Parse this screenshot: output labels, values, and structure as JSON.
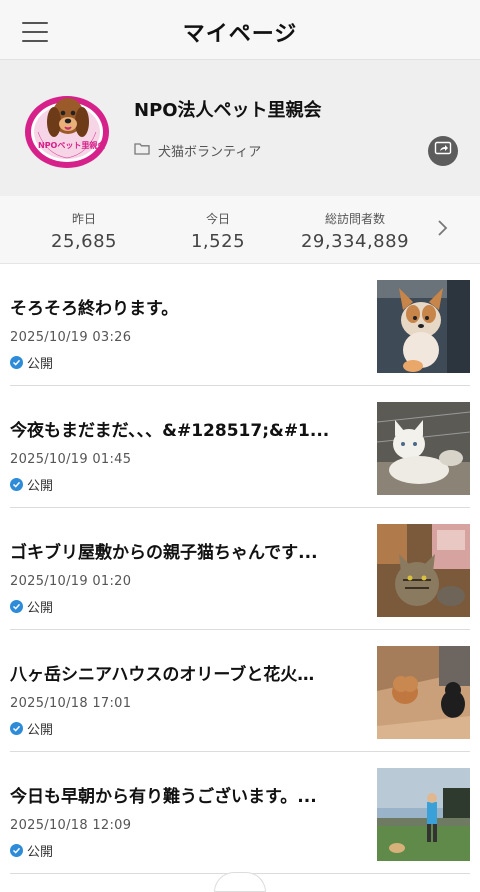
{
  "header": {
    "title": "マイページ"
  },
  "profile": {
    "blog_name": "NPO法人ペット里親会",
    "category": "犬猫ボランティア",
    "logo_text": "NPOペット里親会"
  },
  "stats": [
    {
      "label": "昨日",
      "value": "25,685"
    },
    {
      "label": "今日",
      "value": "1,525"
    },
    {
      "label": "総訪問者数",
      "value": "29,334,889"
    }
  ],
  "posts": [
    {
      "title": "そろそろ終わります。",
      "date": "2025/10/19 03:26",
      "status": "公開",
      "thumb": "corgi-puppy"
    },
    {
      "title": "今夜もまだまだ、、、&#128517;&#1...",
      "date": "2025/10/19 01:45",
      "status": "公開",
      "thumb": "white-kitten"
    },
    {
      "title": "ゴキブリ屋敷からの親子猫ちゃんです...",
      "date": "2025/10/19 01:20",
      "status": "公開",
      "thumb": "tabby-cats"
    },
    {
      "title": "八ヶ岳シニアハウスのオリーブと花火…",
      "date": "2025/10/18 17:01",
      "status": "公開",
      "thumb": "poodle-dogs"
    },
    {
      "title": "今日も早朝から有り難うございます。...",
      "date": "2025/10/18 12:09",
      "status": "公開",
      "thumb": "outdoor-field"
    }
  ],
  "colors": {
    "accent": "#2e8bd8",
    "logo_magenta": "#d6218a",
    "share_bg": "#5c5c5c"
  }
}
